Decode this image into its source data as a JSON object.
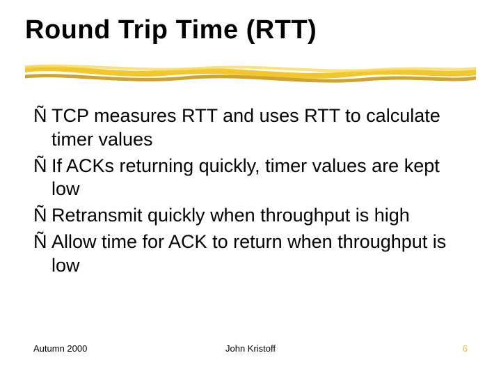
{
  "title": "Round Trip Time (RTT)",
  "bullet_glyph": "Ñ",
  "bullets": [
    {
      "text": "TCP measures RTT and uses RTT to calculate timer values"
    },
    {
      "text": "If ACKs returning quickly, timer values are kept low"
    },
    {
      "text": "Retransmit quickly when throughput is high"
    },
    {
      "text": "Allow time for ACK to return when throughput is low"
    }
  ],
  "footer": {
    "left": "Autumn 2000",
    "center": "John Kristoff",
    "right": "6"
  },
  "colors": {
    "accent": "#f2c72e",
    "accent_dark": "#c99a1a"
  }
}
